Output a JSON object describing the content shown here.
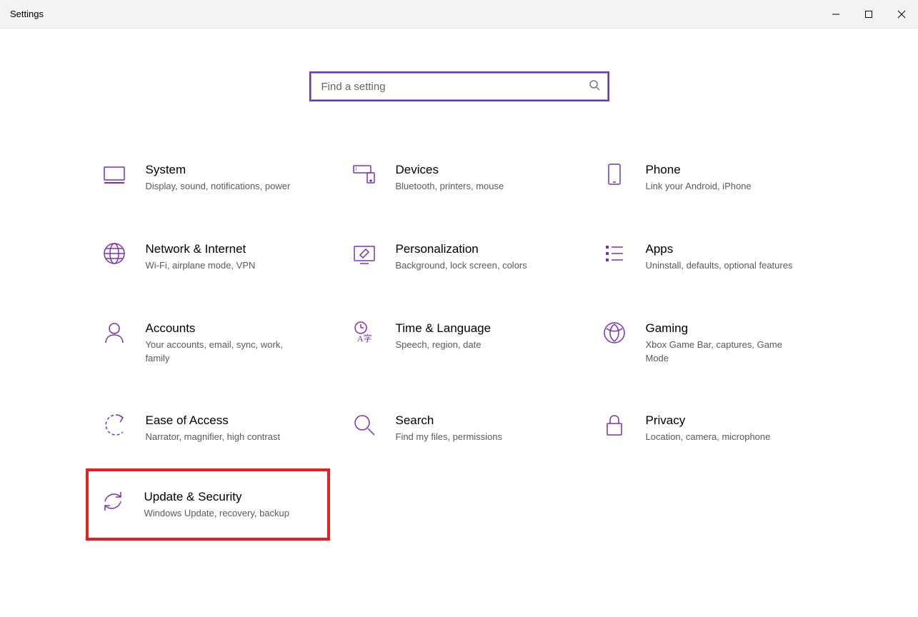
{
  "window": {
    "title": "Settings"
  },
  "search": {
    "placeholder": "Find a setting"
  },
  "tiles": [
    {
      "key": "system",
      "title": "System",
      "desc": "Display, sound, notifications, power"
    },
    {
      "key": "devices",
      "title": "Devices",
      "desc": "Bluetooth, printers, mouse"
    },
    {
      "key": "phone",
      "title": "Phone",
      "desc": "Link your Android, iPhone"
    },
    {
      "key": "network",
      "title": "Network & Internet",
      "desc": "Wi-Fi, airplane mode, VPN"
    },
    {
      "key": "personalization",
      "title": "Personalization",
      "desc": "Background, lock screen, colors"
    },
    {
      "key": "apps",
      "title": "Apps",
      "desc": "Uninstall, defaults, optional features"
    },
    {
      "key": "accounts",
      "title": "Accounts",
      "desc": "Your accounts, email, sync, work, family"
    },
    {
      "key": "time",
      "title": "Time & Language",
      "desc": "Speech, region, date"
    },
    {
      "key": "gaming",
      "title": "Gaming",
      "desc": "Xbox Game Bar, captures, Game Mode"
    },
    {
      "key": "ease",
      "title": "Ease of Access",
      "desc": "Narrator, magnifier, high contrast"
    },
    {
      "key": "search",
      "title": "Search",
      "desc": "Find my files, permissions"
    },
    {
      "key": "privacy",
      "title": "Privacy",
      "desc": "Location, camera, microphone"
    },
    {
      "key": "update",
      "title": "Update & Security",
      "desc": "Windows Update, recovery, backup",
      "highlight": true
    }
  ],
  "colors": {
    "accent": "#7b2fbf",
    "highlight": "#ee1c1c"
  }
}
